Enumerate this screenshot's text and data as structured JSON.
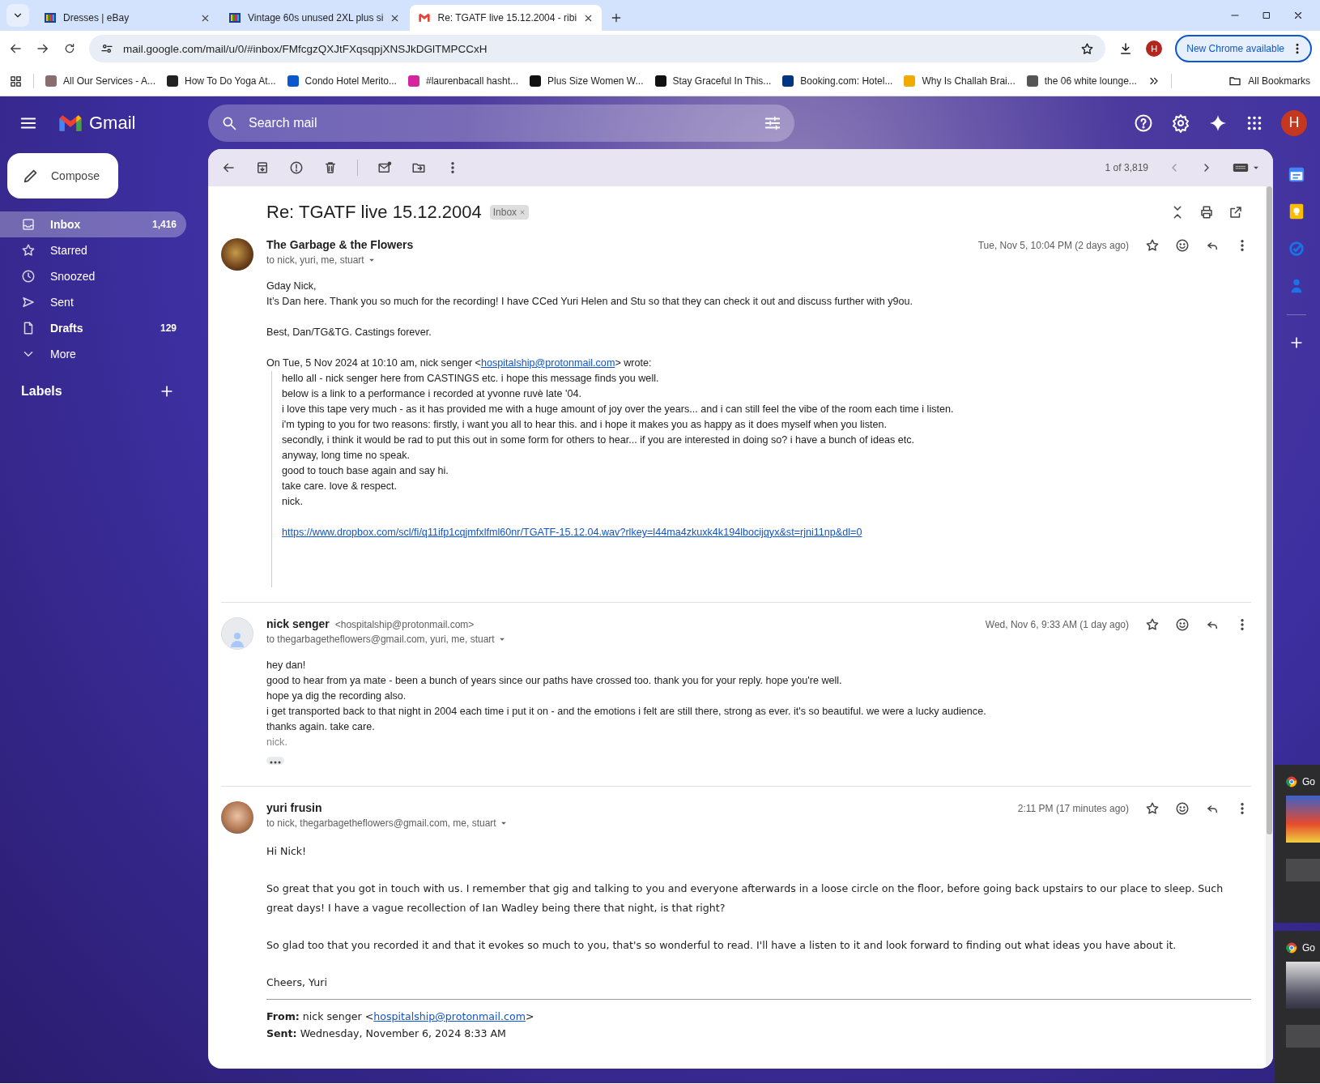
{
  "browser": {
    "tabs": [
      {
        "title": "Dresses | eBay",
        "selected": false
      },
      {
        "title": "Vintage 60s unused 2XL plus si",
        "selected": false
      },
      {
        "title": "Re: TGATF live 15.12.2004 - ribi",
        "selected": true
      }
    ],
    "url": "mail.google.com/mail/u/0/#inbox/FMfcgzQXJtFXqsqpjXNSJkDGlTMPCCxH",
    "profile_initial": "H",
    "update_button": "New Chrome available",
    "bookmarks": [
      {
        "label": "All Our Services - A..."
      },
      {
        "label": "How To Do Yoga At..."
      },
      {
        "label": "Condo Hotel Merito..."
      },
      {
        "label": "#laurenbacall hasht..."
      },
      {
        "label": "Plus Size Women W..."
      },
      {
        "label": "Stay Graceful In This..."
      },
      {
        "label": "Booking.com: Hotel..."
      },
      {
        "label": "Why Is Challah Brai..."
      },
      {
        "label": "the 06 white lounge..."
      }
    ],
    "all_bookmarks": "All Bookmarks"
  },
  "gmail": {
    "product": "Gmail",
    "search": {
      "placeholder": "Search mail"
    },
    "account_initial": "H",
    "compose": "Compose",
    "nav": [
      {
        "label": "Inbox",
        "count": "1,416",
        "selected": true,
        "unread": true
      },
      {
        "label": "Starred",
        "selected": false,
        "unread": false
      },
      {
        "label": "Snoozed",
        "selected": false,
        "unread": false
      },
      {
        "label": "Sent",
        "selected": false,
        "unread": false
      },
      {
        "label": "Drafts",
        "count": "129",
        "selected": false,
        "unread": true
      },
      {
        "label": "More",
        "selected": false,
        "unread": false
      }
    ],
    "labels_heading": "Labels",
    "pager": "1 of 3,819",
    "thread": {
      "subject": "Re: TGATF live 15.12.2004",
      "label": "Inbox",
      "messages": [
        {
          "sender": "The Garbage & the Flowers",
          "recipients": "to nick, yuri, me, stuart",
          "date": "Tue, Nov 5, 10:04 PM (2 days ago)",
          "paragraphs": [
            [
              "Gday Nick,",
              "It’s Dan here. Thank you so much for the recording! I have CCed Yuri Helen and Stu so that they can check it out and discuss further with y9ou."
            ],
            [
              "Best, Dan/TG&TG. Castings forever."
            ]
          ],
          "quote": {
            "intro_before": "On Tue, 5 Nov 2024 at 10:10 am, nick senger <",
            "intro_link": "hospitalship@protonmail.com",
            "intro_after": "> wrote:",
            "lines": [
              "hello all - nick senger here from CASTINGS etc. i hope this message finds you well.",
              "below is a link to a performance i recorded at yvonne ruvè late '04.",
              "i love this tape very much - as it has provided me with a huge amount of joy over the years... and i can still feel the vibe of the room each time i listen.",
              "i'm typing to you for two reasons: firstly, i want you all to hear this. and i hope it makes you as happy as it does myself when you listen.",
              "secondly, i think it would be rad to put this out in some form for others to hear... if you are interested in doing so? i have a bunch of ideas etc.",
              "anyway, long time no speak.",
              "good to touch base again and say hi.",
              "take care. love & respect.",
              "nick."
            ],
            "link": "https://www.dropbox.com/scl/fi/q11ifp1cqjmfxlfml60nr/TGATF-15.12.04.wav?rlkey=l44ma4zkuxk4k194lbocijqyx&st=rjni11np&dl=0"
          }
        },
        {
          "sender": "nick senger",
          "address": "<hospitalship@protonmail.com>",
          "recipients": "to thegarbagetheflowers@gmail.com, yuri, me, stuart",
          "date": "Wed, Nov 6, 9:33 AM (1 day ago)",
          "paragraphs": [
            [
              "hey dan!",
              "good to hear from ya mate - been a bunch of years since our paths have crossed too. thank you for your reply. hope you're well.",
              "hope ya dig the recording also.",
              "i get transported back to that night in 2004 each time i put it on - and the emotions i felt are still there, strong as ever. it's so beautiful. we were a lucky audience.",
              "thanks again. take care."
            ]
          ],
          "signature": "nick.",
          "trimmed": true
        },
        {
          "sender": "yuri frusin",
          "recipients": "to nick, thegarbagetheflowers@gmail.com, me, stuart",
          "date": "2:11 PM (17 minutes ago)",
          "paragraphs": [
            [
              "Hi Nick!"
            ],
            [
              "So great that you got in touch with us. I remember that gig and talking to you and everyone afterwards in a loose circle on the floor, before going back upstairs to our place to sleep. Such great days! I have a vague recollection of Ian Wadley being there that night, is that right?"
            ],
            [
              "So glad too that you recorded it and that it evokes so much to you, that's so wonderful to read. I'll have a listen to it and look forward to finding out what ideas you have about it."
            ],
            [
              "Cheers, Yuri"
            ]
          ],
          "forwarded": {
            "from_label": "From:",
            "from_before": "nick senger <",
            "from_link": "hospitalship@protonmail.com",
            "from_after": ">",
            "sent_label": "Sent:",
            "sent": "Wednesday, November 6, 2024 8:33 AM"
          }
        }
      ]
    }
  },
  "previews": [
    {
      "title": "Go"
    },
    {
      "title": "Go"
    }
  ]
}
